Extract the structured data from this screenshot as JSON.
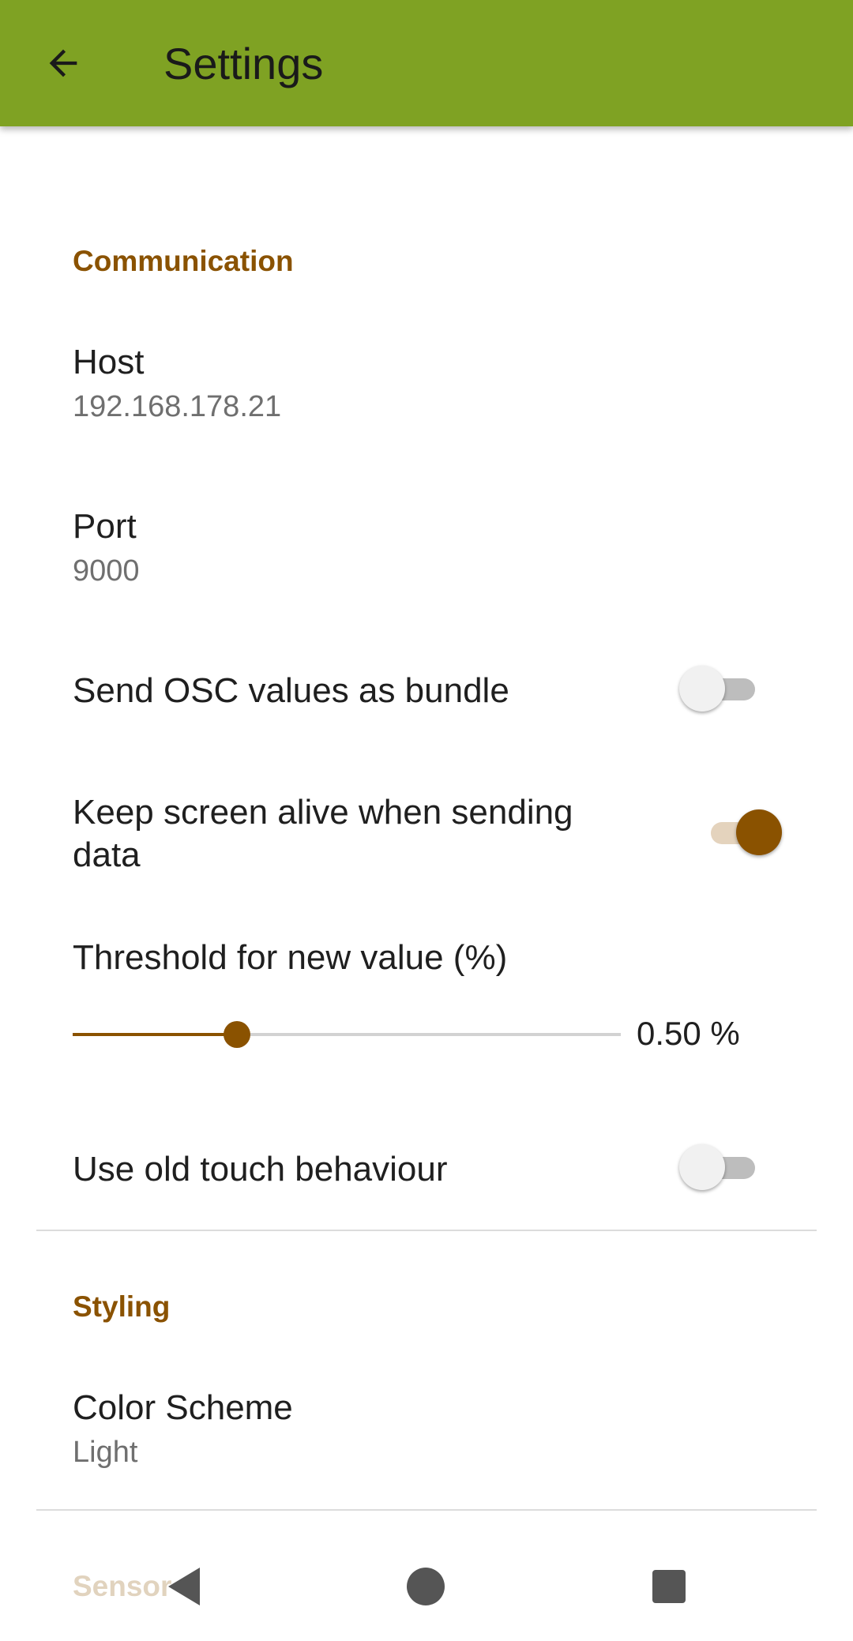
{
  "appbar": {
    "title": "Settings",
    "back_icon": "arrow-back-icon"
  },
  "sections": {
    "communication": {
      "header": "Communication",
      "host": {
        "title": "Host",
        "summary": "192.168.178.21"
      },
      "port": {
        "title": "Port",
        "summary": "9000"
      },
      "bundle": {
        "title": "Send OSC values as bundle",
        "enabled": false
      },
      "keep_alive": {
        "title_line1": "Keep screen alive when sending",
        "title_line2": "data",
        "enabled": true
      },
      "threshold": {
        "title": "Threshold for new value (%)",
        "value_label": "0.50 %",
        "fraction": 0.3
      },
      "old_touch": {
        "title": "Use old touch behaviour",
        "enabled": false
      }
    },
    "styling": {
      "header": "Styling",
      "color_scheme": {
        "title": "Color Scheme",
        "summary": "Light"
      }
    },
    "sensors": {
      "header": "Sensor"
    }
  },
  "navbar": {
    "back_icon": "nav-back-icon",
    "home_icon": "nav-home-icon",
    "recents_icon": "nav-recents-icon"
  },
  "colors": {
    "appbar": "#7fa223",
    "accent": "#8a5200"
  }
}
